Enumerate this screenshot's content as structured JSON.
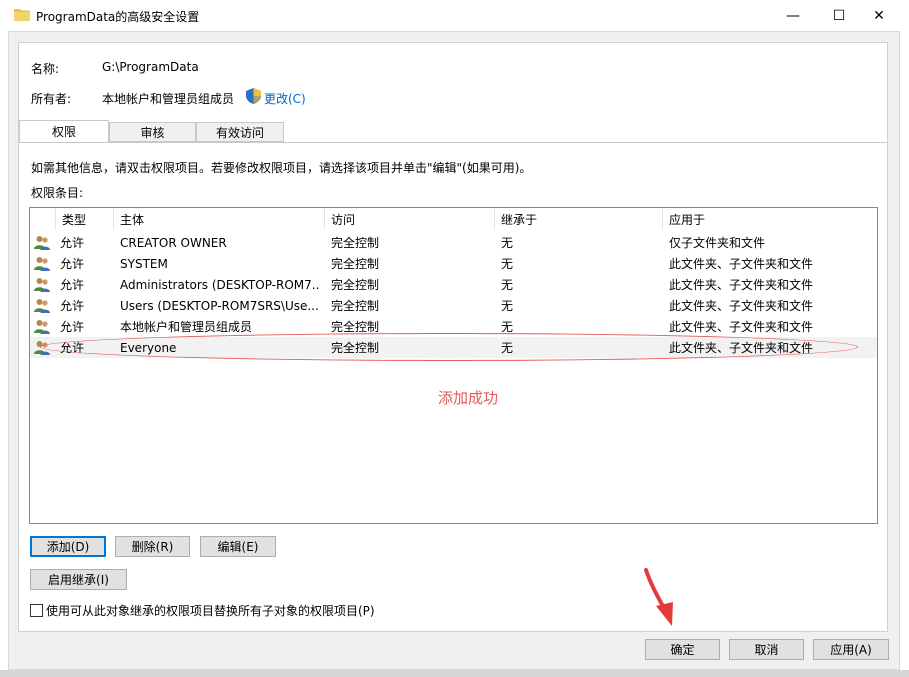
{
  "window": {
    "title": "ProgramData的高级安全设置",
    "minimize": "—",
    "maximize": "☐",
    "close": "✕"
  },
  "info": {
    "name_label": "名称:",
    "name_value": "G:\\ProgramData",
    "owner_label": "所有者:",
    "owner_value": "本地帐户和管理员组成员",
    "change_link": "更改(C)"
  },
  "tabs": [
    {
      "label": "权限",
      "active": true
    },
    {
      "label": "审核",
      "active": false
    },
    {
      "label": "有效访问",
      "active": false
    }
  ],
  "instructions": "如需其他信息，请双击权限项目。若要修改权限项目，请选择该项目并单击\"编辑\"(如果可用)。",
  "entries_label": "权限条目:",
  "columns": [
    "类型",
    "主体",
    "访问",
    "继承于",
    "应用于"
  ],
  "rows": [
    {
      "type": "允许",
      "principal": "CREATOR OWNER",
      "access": "完全控制",
      "inherited": "无",
      "applies": "仅子文件夹和文件"
    },
    {
      "type": "允许",
      "principal": "SYSTEM",
      "access": "完全控制",
      "inherited": "无",
      "applies": "此文件夹、子文件夹和文件"
    },
    {
      "type": "允许",
      "principal": "Administrators (DESKTOP-ROM7...",
      "access": "完全控制",
      "inherited": "无",
      "applies": "此文件夹、子文件夹和文件"
    },
    {
      "type": "允许",
      "principal": "Users (DESKTOP-ROM7SRS\\Use...",
      "access": "完全控制",
      "inherited": "无",
      "applies": "此文件夹、子文件夹和文件"
    },
    {
      "type": "允许",
      "principal": "本地帐户和管理员组成员",
      "access": "完全控制",
      "inherited": "无",
      "applies": "此文件夹、子文件夹和文件"
    },
    {
      "type": "允许",
      "principal": "Everyone",
      "access": "完全控制",
      "inherited": "无",
      "applies": "此文件夹、子文件夹和文件"
    }
  ],
  "annotation": "添加成功",
  "buttons": {
    "add": "添加(D)",
    "remove": "删除(R)",
    "edit": "编辑(E)",
    "enable_inheritance": "启用继承(I)",
    "replace_checkbox": "使用可从此对象继承的权限项目替换所有子对象的权限项目(P)",
    "ok": "确定",
    "cancel": "取消",
    "apply": "应用(A)"
  },
  "colors": {
    "annotation": "#e05a5a",
    "link": "#0066cc",
    "arrow": "#e33b3b"
  }
}
